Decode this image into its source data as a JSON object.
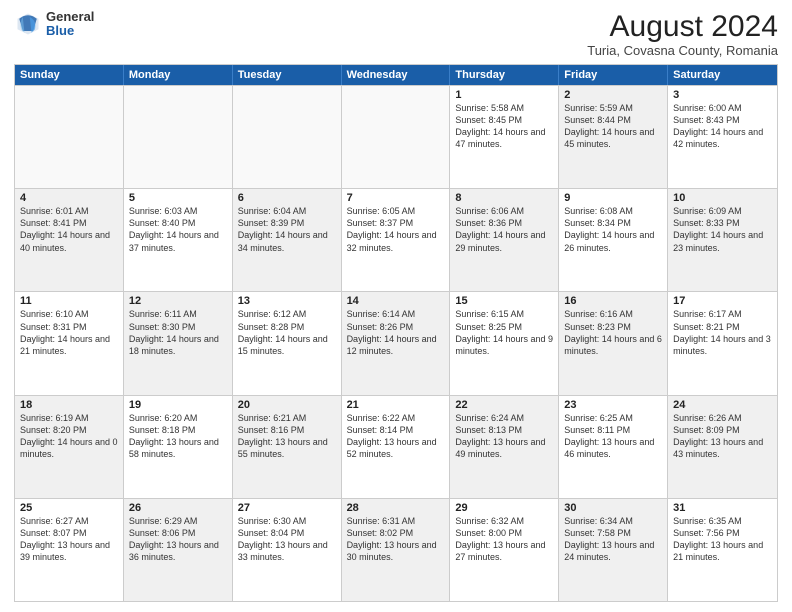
{
  "logo": {
    "general": "General",
    "blue": "Blue"
  },
  "title": "August 2024",
  "subtitle": "Turia, Covasna County, Romania",
  "days": [
    "Sunday",
    "Monday",
    "Tuesday",
    "Wednesday",
    "Thursday",
    "Friday",
    "Saturday"
  ],
  "weeks": [
    [
      {
        "day": "",
        "sunrise": "",
        "sunset": "",
        "daylight": "",
        "shaded": false,
        "empty": true
      },
      {
        "day": "",
        "sunrise": "",
        "sunset": "",
        "daylight": "",
        "shaded": false,
        "empty": true
      },
      {
        "day": "",
        "sunrise": "",
        "sunset": "",
        "daylight": "",
        "shaded": false,
        "empty": true
      },
      {
        "day": "",
        "sunrise": "",
        "sunset": "",
        "daylight": "",
        "shaded": false,
        "empty": true
      },
      {
        "day": "1",
        "sunrise": "Sunrise: 5:58 AM",
        "sunset": "Sunset: 8:45 PM",
        "daylight": "Daylight: 14 hours and 47 minutes.",
        "shaded": false,
        "empty": false
      },
      {
        "day": "2",
        "sunrise": "Sunrise: 5:59 AM",
        "sunset": "Sunset: 8:44 PM",
        "daylight": "Daylight: 14 hours and 45 minutes.",
        "shaded": true,
        "empty": false
      },
      {
        "day": "3",
        "sunrise": "Sunrise: 6:00 AM",
        "sunset": "Sunset: 8:43 PM",
        "daylight": "Daylight: 14 hours and 42 minutes.",
        "shaded": false,
        "empty": false
      }
    ],
    [
      {
        "day": "4",
        "sunrise": "Sunrise: 6:01 AM",
        "sunset": "Sunset: 8:41 PM",
        "daylight": "Daylight: 14 hours and 40 minutes.",
        "shaded": true,
        "empty": false
      },
      {
        "day": "5",
        "sunrise": "Sunrise: 6:03 AM",
        "sunset": "Sunset: 8:40 PM",
        "daylight": "Daylight: 14 hours and 37 minutes.",
        "shaded": false,
        "empty": false
      },
      {
        "day": "6",
        "sunrise": "Sunrise: 6:04 AM",
        "sunset": "Sunset: 8:39 PM",
        "daylight": "Daylight: 14 hours and 34 minutes.",
        "shaded": true,
        "empty": false
      },
      {
        "day": "7",
        "sunrise": "Sunrise: 6:05 AM",
        "sunset": "Sunset: 8:37 PM",
        "daylight": "Daylight: 14 hours and 32 minutes.",
        "shaded": false,
        "empty": false
      },
      {
        "day": "8",
        "sunrise": "Sunrise: 6:06 AM",
        "sunset": "Sunset: 8:36 PM",
        "daylight": "Daylight: 14 hours and 29 minutes.",
        "shaded": true,
        "empty": false
      },
      {
        "day": "9",
        "sunrise": "Sunrise: 6:08 AM",
        "sunset": "Sunset: 8:34 PM",
        "daylight": "Daylight: 14 hours and 26 minutes.",
        "shaded": false,
        "empty": false
      },
      {
        "day": "10",
        "sunrise": "Sunrise: 6:09 AM",
        "sunset": "Sunset: 8:33 PM",
        "daylight": "Daylight: 14 hours and 23 minutes.",
        "shaded": true,
        "empty": false
      }
    ],
    [
      {
        "day": "11",
        "sunrise": "Sunrise: 6:10 AM",
        "sunset": "Sunset: 8:31 PM",
        "daylight": "Daylight: 14 hours and 21 minutes.",
        "shaded": false,
        "empty": false
      },
      {
        "day": "12",
        "sunrise": "Sunrise: 6:11 AM",
        "sunset": "Sunset: 8:30 PM",
        "daylight": "Daylight: 14 hours and 18 minutes.",
        "shaded": true,
        "empty": false
      },
      {
        "day": "13",
        "sunrise": "Sunrise: 6:12 AM",
        "sunset": "Sunset: 8:28 PM",
        "daylight": "Daylight: 14 hours and 15 minutes.",
        "shaded": false,
        "empty": false
      },
      {
        "day": "14",
        "sunrise": "Sunrise: 6:14 AM",
        "sunset": "Sunset: 8:26 PM",
        "daylight": "Daylight: 14 hours and 12 minutes.",
        "shaded": true,
        "empty": false
      },
      {
        "day": "15",
        "sunrise": "Sunrise: 6:15 AM",
        "sunset": "Sunset: 8:25 PM",
        "daylight": "Daylight: 14 hours and 9 minutes.",
        "shaded": false,
        "empty": false
      },
      {
        "day": "16",
        "sunrise": "Sunrise: 6:16 AM",
        "sunset": "Sunset: 8:23 PM",
        "daylight": "Daylight: 14 hours and 6 minutes.",
        "shaded": true,
        "empty": false
      },
      {
        "day": "17",
        "sunrise": "Sunrise: 6:17 AM",
        "sunset": "Sunset: 8:21 PM",
        "daylight": "Daylight: 14 hours and 3 minutes.",
        "shaded": false,
        "empty": false
      }
    ],
    [
      {
        "day": "18",
        "sunrise": "Sunrise: 6:19 AM",
        "sunset": "Sunset: 8:20 PM",
        "daylight": "Daylight: 14 hours and 0 minutes.",
        "shaded": true,
        "empty": false
      },
      {
        "day": "19",
        "sunrise": "Sunrise: 6:20 AM",
        "sunset": "Sunset: 8:18 PM",
        "daylight": "Daylight: 13 hours and 58 minutes.",
        "shaded": false,
        "empty": false
      },
      {
        "day": "20",
        "sunrise": "Sunrise: 6:21 AM",
        "sunset": "Sunset: 8:16 PM",
        "daylight": "Daylight: 13 hours and 55 minutes.",
        "shaded": true,
        "empty": false
      },
      {
        "day": "21",
        "sunrise": "Sunrise: 6:22 AM",
        "sunset": "Sunset: 8:14 PM",
        "daylight": "Daylight: 13 hours and 52 minutes.",
        "shaded": false,
        "empty": false
      },
      {
        "day": "22",
        "sunrise": "Sunrise: 6:24 AM",
        "sunset": "Sunset: 8:13 PM",
        "daylight": "Daylight: 13 hours and 49 minutes.",
        "shaded": true,
        "empty": false
      },
      {
        "day": "23",
        "sunrise": "Sunrise: 6:25 AM",
        "sunset": "Sunset: 8:11 PM",
        "daylight": "Daylight: 13 hours and 46 minutes.",
        "shaded": false,
        "empty": false
      },
      {
        "day": "24",
        "sunrise": "Sunrise: 6:26 AM",
        "sunset": "Sunset: 8:09 PM",
        "daylight": "Daylight: 13 hours and 43 minutes.",
        "shaded": true,
        "empty": false
      }
    ],
    [
      {
        "day": "25",
        "sunrise": "Sunrise: 6:27 AM",
        "sunset": "Sunset: 8:07 PM",
        "daylight": "Daylight: 13 hours and 39 minutes.",
        "shaded": false,
        "empty": false
      },
      {
        "day": "26",
        "sunrise": "Sunrise: 6:29 AM",
        "sunset": "Sunset: 8:06 PM",
        "daylight": "Daylight: 13 hours and 36 minutes.",
        "shaded": true,
        "empty": false
      },
      {
        "day": "27",
        "sunrise": "Sunrise: 6:30 AM",
        "sunset": "Sunset: 8:04 PM",
        "daylight": "Daylight: 13 hours and 33 minutes.",
        "shaded": false,
        "empty": false
      },
      {
        "day": "28",
        "sunrise": "Sunrise: 6:31 AM",
        "sunset": "Sunset: 8:02 PM",
        "daylight": "Daylight: 13 hours and 30 minutes.",
        "shaded": true,
        "empty": false
      },
      {
        "day": "29",
        "sunrise": "Sunrise: 6:32 AM",
        "sunset": "Sunset: 8:00 PM",
        "daylight": "Daylight: 13 hours and 27 minutes.",
        "shaded": false,
        "empty": false
      },
      {
        "day": "30",
        "sunrise": "Sunrise: 6:34 AM",
        "sunset": "Sunset: 7:58 PM",
        "daylight": "Daylight: 13 hours and 24 minutes.",
        "shaded": true,
        "empty": false
      },
      {
        "day": "31",
        "sunrise": "Sunrise: 6:35 AM",
        "sunset": "Sunset: 7:56 PM",
        "daylight": "Daylight: 13 hours and 21 minutes.",
        "shaded": false,
        "empty": false
      }
    ]
  ]
}
